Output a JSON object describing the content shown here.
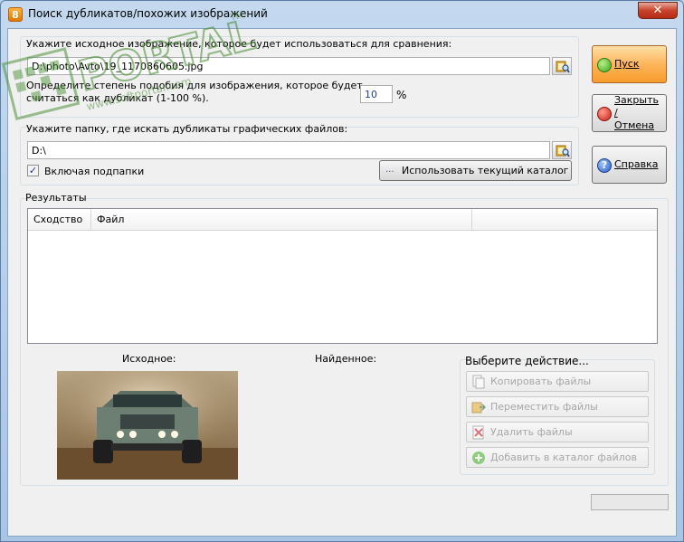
{
  "window": {
    "title": "Поиск дубликатов/похожих изображений",
    "close_glyph": "✕"
  },
  "source": {
    "label": "Укажите исходное изображение, которое будет использоваться для сравнения:",
    "path": "D:\\photo\\Avto\\19_1170860605.jpg"
  },
  "similarity": {
    "label_line1": "Определите степень подобия для изображения, которое будет",
    "label_line2": "считаться как дубликат (1-100 %).",
    "value": "10",
    "unit": "%"
  },
  "folder": {
    "label": "Укажите папку, где искать дубликаты графических файлов:",
    "path": "D:\\",
    "include_subfolders_label": "Включая подпапки",
    "include_subfolders_checked": true,
    "use_current_button": "Использовать текущий каталог"
  },
  "buttons": {
    "start": "Пуск",
    "close_line1": "Закрыть /",
    "close_line2": "Отмена",
    "help": "Справка"
  },
  "results": {
    "label": "Результаты",
    "columns": [
      "Сходство",
      "Файл"
    ],
    "rows": []
  },
  "preview": {
    "original_label": "Исходное:",
    "found_label": "Найденное:"
  },
  "actions": {
    "label": "Выберите действие...",
    "items": [
      "Копировать файлы",
      "Переместить файлы",
      "Удалить файлы",
      "Добавить в каталог файлов"
    ]
  },
  "watermark": {
    "main": "PORTAL",
    "tm": "TM",
    "url": "www.softportal.com"
  }
}
